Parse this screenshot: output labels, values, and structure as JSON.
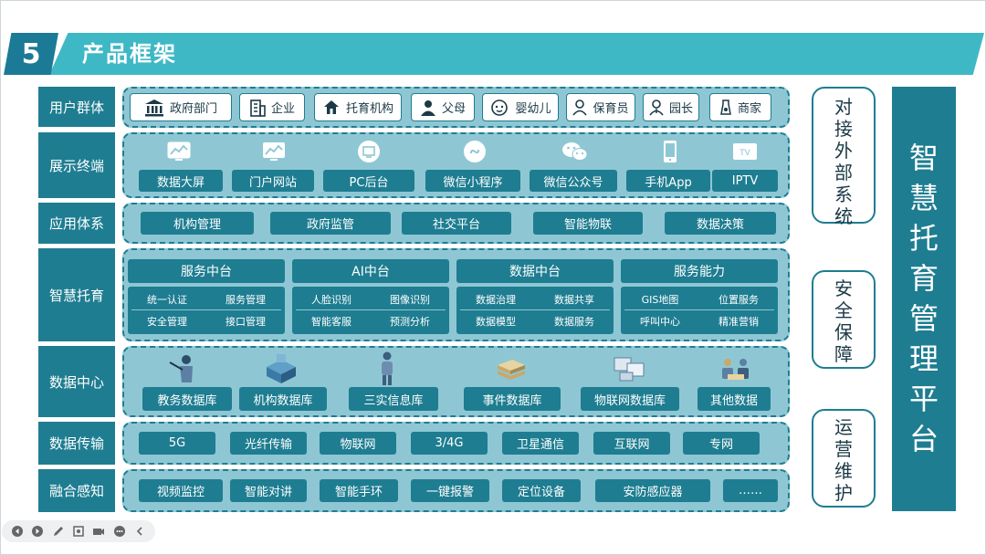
{
  "header": {
    "number": "5",
    "title": "产品框架"
  },
  "layers": [
    {
      "label": "用户群体"
    },
    {
      "label": "展示终端"
    },
    {
      "label": "应用体系"
    },
    {
      "label": "智慧托育"
    },
    {
      "label": "数据中心"
    },
    {
      "label": "数据传输"
    },
    {
      "label": "融合感知"
    }
  ],
  "users": [
    {
      "label": "政府部门",
      "icon": "government-building-icon"
    },
    {
      "label": "企业",
      "icon": "office-building-icon"
    },
    {
      "label": "托育机构",
      "icon": "house-hand-icon"
    },
    {
      "label": "父母",
      "icon": "person-icon"
    },
    {
      "label": "婴幼儿",
      "icon": "baby-face-icon"
    },
    {
      "label": "保育员",
      "icon": "caregiver-icon"
    },
    {
      "label": "园长",
      "icon": "principal-icon"
    },
    {
      "label": "商家",
      "icon": "merchant-icon"
    }
  ],
  "terminals": [
    {
      "label": "数据大屏",
      "icon": "chart-screen-icon"
    },
    {
      "label": "门户网站",
      "icon": "chart-screen-icon"
    },
    {
      "label": "PC后台",
      "icon": "pc-circle-icon"
    },
    {
      "label": "微信小程序",
      "icon": "mini-program-icon"
    },
    {
      "label": "微信公众号",
      "icon": "wechat-icon"
    },
    {
      "label": "手机App",
      "icon": "phone-icon"
    },
    {
      "label": "IPTV",
      "icon": "tv-icon",
      "icon_text": "TV"
    }
  ],
  "applications": [
    "机构管理",
    "政府监管",
    "社交平台",
    "智能物联",
    "数据决策"
  ],
  "smart_care": [
    {
      "title": "服务中台",
      "items": [
        "统一认证",
        "服务管理",
        "安全管理",
        "接口管理"
      ]
    },
    {
      "title": "AI中台",
      "items": [
        "人脸识别",
        "图像识别",
        "智能客服",
        "预测分析"
      ]
    },
    {
      "title": "数据中台",
      "items": [
        "数据治理",
        "数据共享",
        "数据模型",
        "数据服务"
      ]
    },
    {
      "title": "服务能力",
      "items": [
        "GIS地图",
        "位置服务",
        "呼叫中心",
        "精准营销"
      ]
    }
  ],
  "data_center": [
    {
      "label": "教务数据库",
      "icon": "teacher-icon"
    },
    {
      "label": "机构数据库",
      "icon": "building-db-icon"
    },
    {
      "label": "三实信息库",
      "icon": "person-standing-icon"
    },
    {
      "label": "事件数据库",
      "icon": "stack-files-icon"
    },
    {
      "label": "物联网数据库",
      "icon": "iot-devices-icon"
    },
    {
      "label": "其他数据",
      "icon": "people-group-icon"
    }
  ],
  "transmission": [
    "5G",
    "光纤传输",
    "物联网",
    "3/4G",
    "卫星通信",
    "互联网",
    "专网"
  ],
  "perception": [
    "视频监控",
    "智能对讲",
    "智能手环",
    "一键报警",
    "定位设备",
    "安防感应器",
    "……"
  ],
  "side_boxes": [
    {
      "text": "对接外部系统"
    },
    {
      "text": "安全保障"
    },
    {
      "text": "运营维护"
    }
  ],
  "platform": {
    "text": "智慧托育管理平台"
  },
  "colors": {
    "primary": "#1e7d91",
    "accent": "#3fb8c6",
    "panel": "#8ec7d3"
  }
}
